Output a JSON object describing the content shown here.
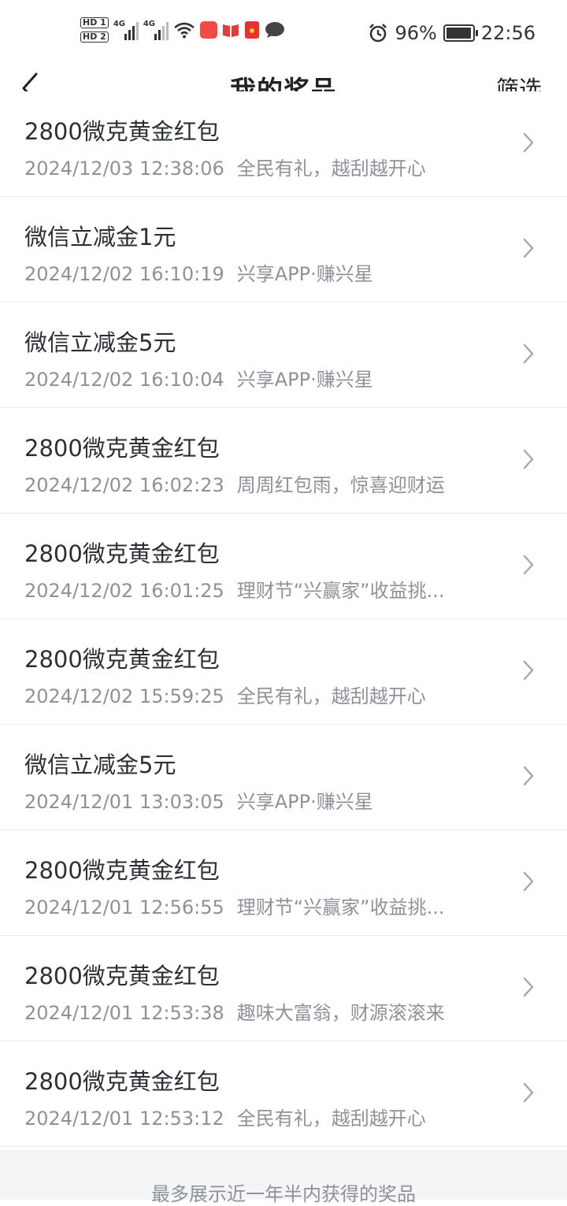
{
  "status_bar": {
    "sim1": "HD 1",
    "sim2": "HD 2",
    "network1": "4G",
    "network2": "4G",
    "battery_pct": "96%",
    "battery_level": 0.96,
    "time": "22:56",
    "icons": [
      "wifi-icon",
      "shopping-app-icon",
      "book-app-icon",
      "red-envelope-app-icon",
      "chat-app-icon",
      "alarm-icon",
      "charging-battery-icon"
    ]
  },
  "header": {
    "title": "我的奖品",
    "filter_label": "筛选"
  },
  "prizes": [
    {
      "name": "2800微克黄金红包",
      "time": "2024/12/03 12:38:06",
      "source": "全民有礼，越刮越开心"
    },
    {
      "name": "微信立减金1元",
      "time": "2024/12/02 16:10:19",
      "source": "兴享APP·赚兴星"
    },
    {
      "name": "微信立减金5元",
      "time": "2024/12/02 16:10:04",
      "source": "兴享APP·赚兴星"
    },
    {
      "name": "2800微克黄金红包",
      "time": "2024/12/02 16:02:23",
      "source": "周周红包雨，惊喜迎财运"
    },
    {
      "name": "2800微克黄金红包",
      "time": "2024/12/02 16:01:25",
      "source": "理财节“兴赢家”收益挑..."
    },
    {
      "name": "2800微克黄金红包",
      "time": "2024/12/02 15:59:25",
      "source": "全民有礼，越刮越开心"
    },
    {
      "name": "微信立减金5元",
      "time": "2024/12/01 13:03:05",
      "source": "兴享APP·赚兴星"
    },
    {
      "name": "2800微克黄金红包",
      "time": "2024/12/01 12:56:55",
      "source": "理财节“兴赢家”收益挑..."
    },
    {
      "name": "2800微克黄金红包",
      "time": "2024/12/01 12:53:38",
      "source": "趣味大富翁，财源滚滚来"
    },
    {
      "name": "2800微克黄金红包",
      "time": "2024/12/01 12:53:12",
      "source": "全民有礼，越刮越开心"
    }
  ],
  "footer": {
    "note": "最多展示近一年半内获得的奖品"
  }
}
